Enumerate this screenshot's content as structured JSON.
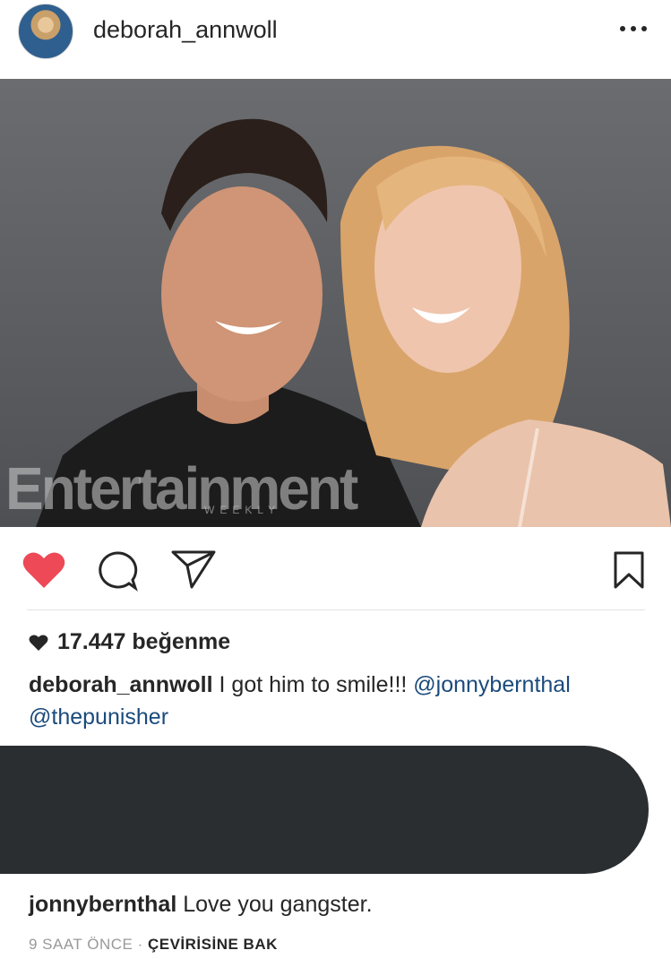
{
  "header": {
    "username": "deborah_annwoll",
    "more_icon": "ellipsis-icon"
  },
  "photo": {
    "watermark": "Entertainment",
    "watermark_sub": "WEEKLY"
  },
  "actions": {
    "like_icon": "heart-filled-icon",
    "comment_icon": "comment-icon",
    "share_icon": "send-icon",
    "save_icon": "bookmark-icon",
    "like_color": "#ed4956"
  },
  "likes": {
    "count_text": "17.447 beğenme"
  },
  "caption": {
    "username": "deborah_annwoll",
    "text": " I got him to smile!!! ",
    "mention1": "@jonnybernthal",
    "mention2": "@thepunisher"
  },
  "comment": {
    "username": "jonnybernthal",
    "text": " Love you gangster."
  },
  "meta": {
    "time": "9 SAAT ÖNCE",
    "separator": " · ",
    "translate": "ÇEVİRİSİNE BAK"
  },
  "colors": {
    "mention": "#1b4a7c",
    "redaction": "#2b2e31"
  }
}
